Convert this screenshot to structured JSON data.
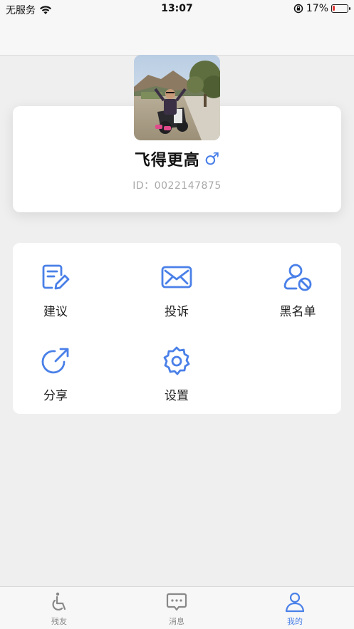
{
  "status_bar": {
    "carrier": "无服务",
    "time": "13:07",
    "battery_percent": "17%",
    "battery_level": 0.17,
    "battery_color": "#e33333"
  },
  "profile": {
    "name": "飞得更高",
    "gender_symbol": "♂",
    "id_text": "ID：0022147875"
  },
  "menu": {
    "items": [
      {
        "label": "建议",
        "icon": "edit-document-icon"
      },
      {
        "label": "投诉",
        "icon": "envelope-icon"
      },
      {
        "label": "黑名单",
        "icon": "user-blocked-icon"
      },
      {
        "label": "分享",
        "icon": "share-icon"
      },
      {
        "label": "设置",
        "icon": "gear-icon"
      }
    ]
  },
  "tabs": [
    {
      "label": "残友",
      "icon": "wheelchair-icon",
      "active": false
    },
    {
      "label": "消息",
      "icon": "message-icon",
      "active": false
    },
    {
      "label": "我的",
      "icon": "user-icon",
      "active": true
    }
  ],
  "colors": {
    "accent": "#4a80e8",
    "background": "#efefef",
    "card": "#ffffff"
  }
}
